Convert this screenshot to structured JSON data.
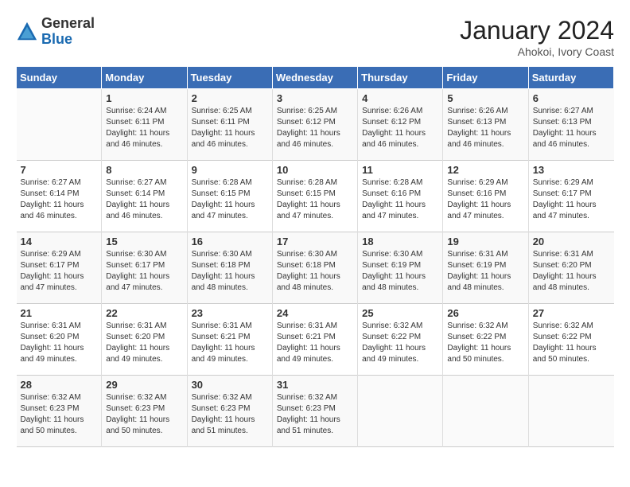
{
  "header": {
    "logo_general": "General",
    "logo_blue": "Blue",
    "month_title": "January 2024",
    "location": "Ahokoi, Ivory Coast"
  },
  "weekdays": [
    "Sunday",
    "Monday",
    "Tuesday",
    "Wednesday",
    "Thursday",
    "Friday",
    "Saturday"
  ],
  "weeks": [
    [
      {
        "day": "",
        "sunrise": "",
        "sunset": "",
        "daylight": ""
      },
      {
        "day": "1",
        "sunrise": "Sunrise: 6:24 AM",
        "sunset": "Sunset: 6:11 PM",
        "daylight": "Daylight: 11 hours and 46 minutes."
      },
      {
        "day": "2",
        "sunrise": "Sunrise: 6:25 AM",
        "sunset": "Sunset: 6:11 PM",
        "daylight": "Daylight: 11 hours and 46 minutes."
      },
      {
        "day": "3",
        "sunrise": "Sunrise: 6:25 AM",
        "sunset": "Sunset: 6:12 PM",
        "daylight": "Daylight: 11 hours and 46 minutes."
      },
      {
        "day": "4",
        "sunrise": "Sunrise: 6:26 AM",
        "sunset": "Sunset: 6:12 PM",
        "daylight": "Daylight: 11 hours and 46 minutes."
      },
      {
        "day": "5",
        "sunrise": "Sunrise: 6:26 AM",
        "sunset": "Sunset: 6:13 PM",
        "daylight": "Daylight: 11 hours and 46 minutes."
      },
      {
        "day": "6",
        "sunrise": "Sunrise: 6:27 AM",
        "sunset": "Sunset: 6:13 PM",
        "daylight": "Daylight: 11 hours and 46 minutes."
      }
    ],
    [
      {
        "day": "7",
        "sunrise": "Sunrise: 6:27 AM",
        "sunset": "Sunset: 6:14 PM",
        "daylight": "Daylight: 11 hours and 46 minutes."
      },
      {
        "day": "8",
        "sunrise": "Sunrise: 6:27 AM",
        "sunset": "Sunset: 6:14 PM",
        "daylight": "Daylight: 11 hours and 46 minutes."
      },
      {
        "day": "9",
        "sunrise": "Sunrise: 6:28 AM",
        "sunset": "Sunset: 6:15 PM",
        "daylight": "Daylight: 11 hours and 47 minutes."
      },
      {
        "day": "10",
        "sunrise": "Sunrise: 6:28 AM",
        "sunset": "Sunset: 6:15 PM",
        "daylight": "Daylight: 11 hours and 47 minutes."
      },
      {
        "day": "11",
        "sunrise": "Sunrise: 6:28 AM",
        "sunset": "Sunset: 6:16 PM",
        "daylight": "Daylight: 11 hours and 47 minutes."
      },
      {
        "day": "12",
        "sunrise": "Sunrise: 6:29 AM",
        "sunset": "Sunset: 6:16 PM",
        "daylight": "Daylight: 11 hours and 47 minutes."
      },
      {
        "day": "13",
        "sunrise": "Sunrise: 6:29 AM",
        "sunset": "Sunset: 6:17 PM",
        "daylight": "Daylight: 11 hours and 47 minutes."
      }
    ],
    [
      {
        "day": "14",
        "sunrise": "Sunrise: 6:29 AM",
        "sunset": "Sunset: 6:17 PM",
        "daylight": "Daylight: 11 hours and 47 minutes."
      },
      {
        "day": "15",
        "sunrise": "Sunrise: 6:30 AM",
        "sunset": "Sunset: 6:17 PM",
        "daylight": "Daylight: 11 hours and 47 minutes."
      },
      {
        "day": "16",
        "sunrise": "Sunrise: 6:30 AM",
        "sunset": "Sunset: 6:18 PM",
        "daylight": "Daylight: 11 hours and 48 minutes."
      },
      {
        "day": "17",
        "sunrise": "Sunrise: 6:30 AM",
        "sunset": "Sunset: 6:18 PM",
        "daylight": "Daylight: 11 hours and 48 minutes."
      },
      {
        "day": "18",
        "sunrise": "Sunrise: 6:30 AM",
        "sunset": "Sunset: 6:19 PM",
        "daylight": "Daylight: 11 hours and 48 minutes."
      },
      {
        "day": "19",
        "sunrise": "Sunrise: 6:31 AM",
        "sunset": "Sunset: 6:19 PM",
        "daylight": "Daylight: 11 hours and 48 minutes."
      },
      {
        "day": "20",
        "sunrise": "Sunrise: 6:31 AM",
        "sunset": "Sunset: 6:20 PM",
        "daylight": "Daylight: 11 hours and 48 minutes."
      }
    ],
    [
      {
        "day": "21",
        "sunrise": "Sunrise: 6:31 AM",
        "sunset": "Sunset: 6:20 PM",
        "daylight": "Daylight: 11 hours and 49 minutes."
      },
      {
        "day": "22",
        "sunrise": "Sunrise: 6:31 AM",
        "sunset": "Sunset: 6:20 PM",
        "daylight": "Daylight: 11 hours and 49 minutes."
      },
      {
        "day": "23",
        "sunrise": "Sunrise: 6:31 AM",
        "sunset": "Sunset: 6:21 PM",
        "daylight": "Daylight: 11 hours and 49 minutes."
      },
      {
        "day": "24",
        "sunrise": "Sunrise: 6:31 AM",
        "sunset": "Sunset: 6:21 PM",
        "daylight": "Daylight: 11 hours and 49 minutes."
      },
      {
        "day": "25",
        "sunrise": "Sunrise: 6:32 AM",
        "sunset": "Sunset: 6:22 PM",
        "daylight": "Daylight: 11 hours and 49 minutes."
      },
      {
        "day": "26",
        "sunrise": "Sunrise: 6:32 AM",
        "sunset": "Sunset: 6:22 PM",
        "daylight": "Daylight: 11 hours and 50 minutes."
      },
      {
        "day": "27",
        "sunrise": "Sunrise: 6:32 AM",
        "sunset": "Sunset: 6:22 PM",
        "daylight": "Daylight: 11 hours and 50 minutes."
      }
    ],
    [
      {
        "day": "28",
        "sunrise": "Sunrise: 6:32 AM",
        "sunset": "Sunset: 6:23 PM",
        "daylight": "Daylight: 11 hours and 50 minutes."
      },
      {
        "day": "29",
        "sunrise": "Sunrise: 6:32 AM",
        "sunset": "Sunset: 6:23 PM",
        "daylight": "Daylight: 11 hours and 50 minutes."
      },
      {
        "day": "30",
        "sunrise": "Sunrise: 6:32 AM",
        "sunset": "Sunset: 6:23 PM",
        "daylight": "Daylight: 11 hours and 51 minutes."
      },
      {
        "day": "31",
        "sunrise": "Sunrise: 6:32 AM",
        "sunset": "Sunset: 6:23 PM",
        "daylight": "Daylight: 11 hours and 51 minutes."
      },
      {
        "day": "",
        "sunrise": "",
        "sunset": "",
        "daylight": ""
      },
      {
        "day": "",
        "sunrise": "",
        "sunset": "",
        "daylight": ""
      },
      {
        "day": "",
        "sunrise": "",
        "sunset": "",
        "daylight": ""
      }
    ]
  ]
}
